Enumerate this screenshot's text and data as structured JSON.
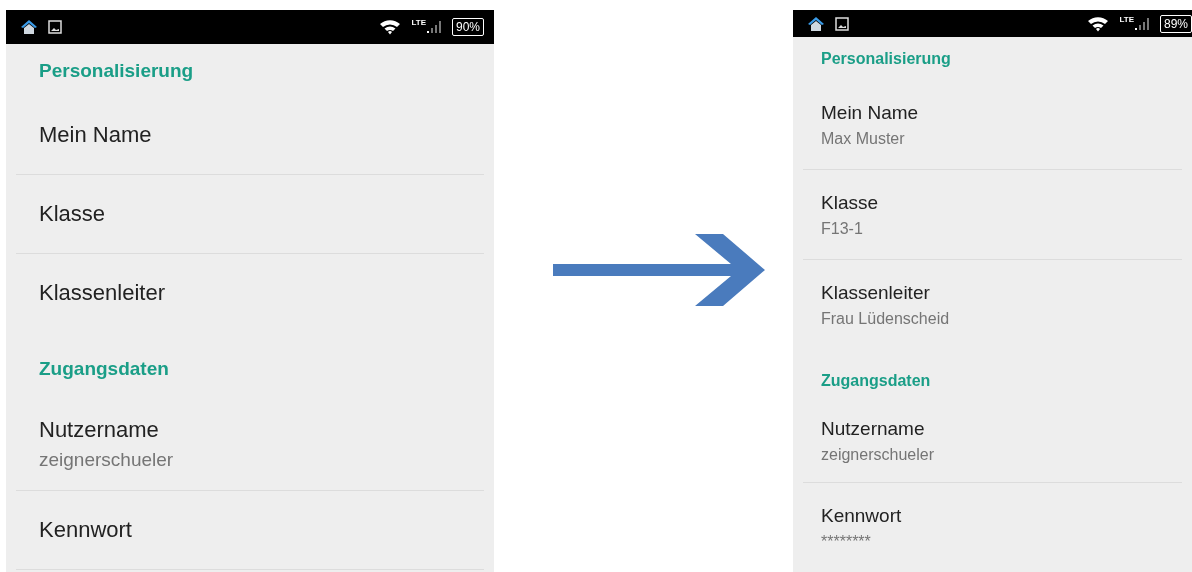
{
  "screens": [
    {
      "status_bar": {
        "network": "LTE",
        "battery": "90%"
      },
      "sections": [
        {
          "header": "Personalisierung",
          "items": [
            {
              "title": "Mein Name"
            },
            {
              "title": "Klasse"
            },
            {
              "title": "Klassenleiter"
            }
          ]
        },
        {
          "header": "Zugangsdaten",
          "items": [
            {
              "title": "Nutzername",
              "summary": "zeignerschueler"
            },
            {
              "title": "Kennwort"
            }
          ]
        }
      ]
    },
    {
      "status_bar": {
        "network": "LTE",
        "battery": "89%"
      },
      "sections": [
        {
          "header": "Personalisierung",
          "items": [
            {
              "title": "Mein Name",
              "summary": "Max Muster"
            },
            {
              "title": "Klasse",
              "summary": "F13-1"
            },
            {
              "title": "Klassenleiter",
              "summary": "Frau Lüdenscheid"
            }
          ]
        },
        {
          "header": "Zugangsdaten",
          "items": [
            {
              "title": "Nutzername",
              "summary": "zeignerschueler"
            },
            {
              "title": "Kennwort",
              "summary": "********"
            }
          ]
        }
      ]
    }
  ]
}
